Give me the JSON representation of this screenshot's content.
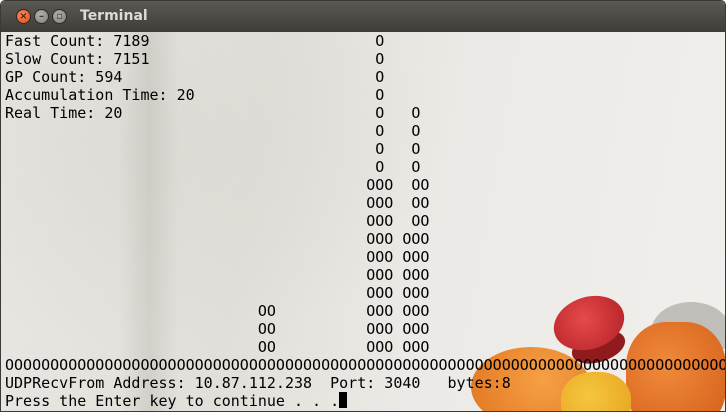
{
  "window": {
    "title": "Terminal",
    "buttons": {
      "close": "×",
      "minimize": "–",
      "maximize": "▫"
    }
  },
  "terminal": {
    "lines": [
      "Fast Count: 7189                         O",
      "Slow Count: 7151                         O",
      "GP Count: 594                            O",
      "Accumulation Time: 20                    O",
      "Real Time: 20                            O   O",
      "                                         O   O",
      "                                         O   O",
      "                                         O   O",
      "                                        OOO  OO",
      "                                        OOO  OO",
      "                                        OOO  OO",
      "                                        OOO OOO",
      "                                        OOO OOO",
      "                                        OOO OOO",
      "                                        OOO OOO",
      "                            OO          OOO OOO",
      "                            OO          OOO OOO",
      "                            OO          OOO OOO",
      "OOOOOOOOOOOOOOOOOOOOOOOOOOOOOOOOOOOOOOOOOOOOOOOOOOOOOOOOOOOOOOOOOOOOOOOOOOOOOOOOO",
      "UDPRecvFrom Address: 10.87.112.238  Port: 3040   bytes:8"
    ],
    "prompt": "Press the Enter key to continue . . ."
  }
}
